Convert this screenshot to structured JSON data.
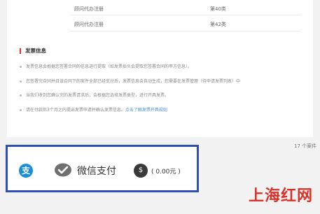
{
  "service_rows": [
    {
      "name": "顾问代办注册",
      "cls": "第40类"
    },
    {
      "name": "顾问代办注册",
      "cls": "第42类"
    }
  ],
  "invoice": {
    "title": "发票信息",
    "notes": [
      {
        "text": "发票信息会根据您签署合同的信息进行提取（如发票抬头会提取您签署合同的甲方信息）。",
        "link": ""
      },
      {
        "text": "您签署完合同并且该合同下的案件全部已经支付后，发票信息会自动生成，您需要在发票管理（待申请发票列表）中",
        "link": ""
      },
      {
        "text": "当我们收到您确认完的发票请求后，会根据您选择发票类型，进行开具发票。",
        "link": ""
      },
      {
        "text": "请在付款后3个月之内提出发票申请并确认发票信息。",
        "link": "点击了解发票开具规则"
      }
    ]
  },
  "pager_text": "17 个案件",
  "payment": {
    "alipay_icon": "alipay-icon",
    "alipay_glyph": "支",
    "wechat_label": "微信支付",
    "balance_icon": "money-bag-icon",
    "balance_glyph": "$",
    "balance_amount": "( 0.00元 )",
    "colors": {
      "highlight_border": "#2f4fb4",
      "alipay": "#1a8fd5",
      "wechat": "#6f6f6f"
    }
  },
  "watermark": "上海红网"
}
